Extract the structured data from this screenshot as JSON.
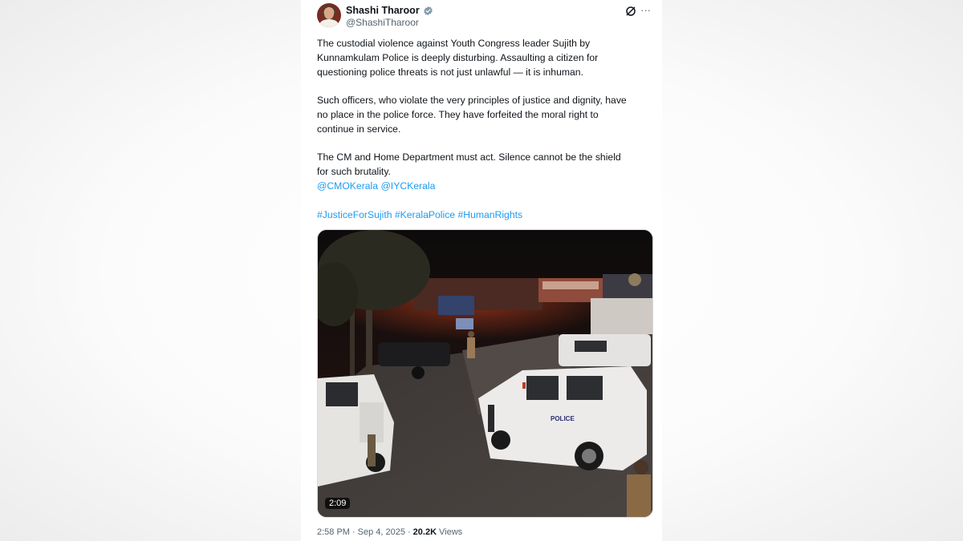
{
  "tweet": {
    "author": {
      "display_name": "Shashi Tharoor",
      "handle": "@ShashiTharoor",
      "verified": true,
      "verified_color": "#829aab"
    },
    "header_icons": [
      "grok-icon",
      "more-icon"
    ],
    "more_label": "···",
    "lines": {
      "p1_l1": "The custodial violence against Youth Congress leader Sujith by",
      "p1_l2": "Kunnamkulam Police is deeply disturbing. Assaulting a citizen for",
      "p1_l3": "questioning police threats is not just unlawful — it is inhuman.",
      "p2_l1": "Such officers, who violate the very principles of justice and dignity, have",
      "p2_l2": "no place in the police force. They have forfeited the moral right to",
      "p2_l3": "continue in service.",
      "p3_l1": "The CM and Home Department must act. Silence cannot be the shield",
      "p3_l2": "for such brutality."
    },
    "mentions": [
      "@CMOKerala",
      "@IYCKerala"
    ],
    "hashtags": [
      "#JusticeForSujith",
      "#KeralaPolice",
      "#HumanRights"
    ],
    "media": {
      "type": "video",
      "duration": "2:09",
      "vehicle_label": "POLICE"
    },
    "meta": {
      "time": "2:58 PM",
      "separator": "·",
      "date": "Sep 4, 2025",
      "views_count": "20.2K",
      "views_label": "Views"
    },
    "colors": {
      "text": "#0f1419",
      "secondary": "#536471",
      "link": "#1d9bf0"
    }
  }
}
